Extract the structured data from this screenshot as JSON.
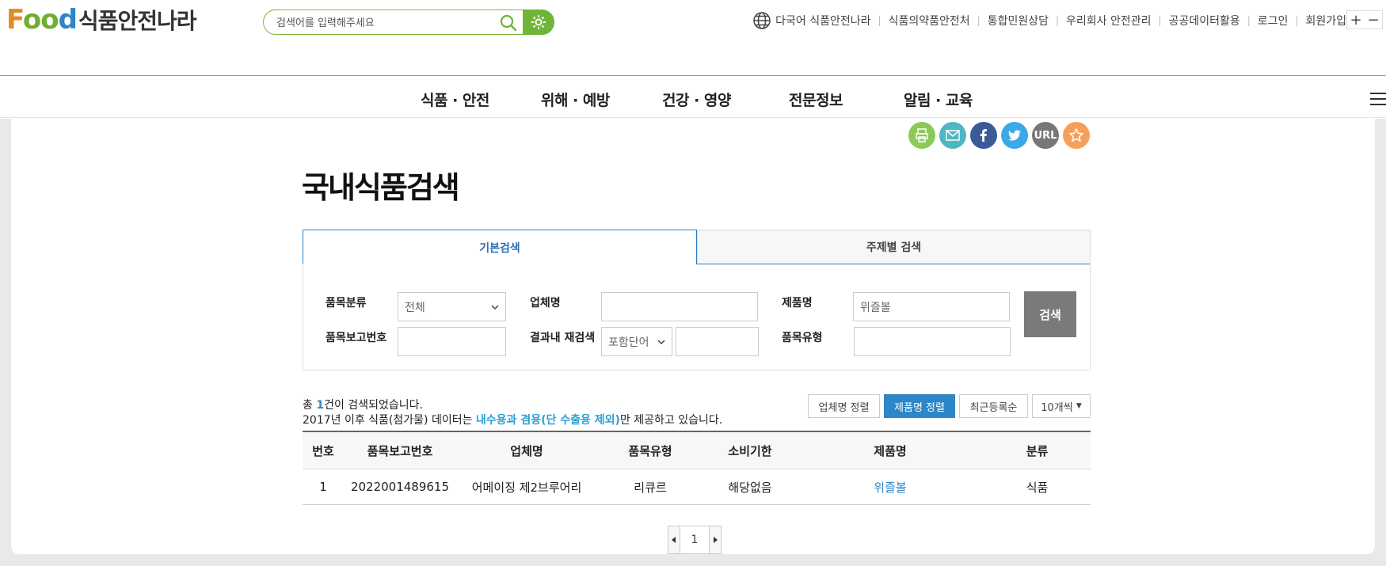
{
  "logo": {
    "en_f": "F",
    "en_oo": "oo",
    "en_d": "d",
    "kr": "식품안전나라"
  },
  "search": {
    "placeholder": "검색어를 입력해주세요"
  },
  "util_nav": [
    "다국어 식품안전나라",
    "식품의약품안전처",
    "통합민원상담",
    "우리회사 안전관리",
    "공공데이터활용",
    "로그인",
    "회원가입"
  ],
  "zoom": {
    "plus": "+",
    "minus": "−"
  },
  "main_nav": [
    "식품 · 안전",
    "위해 · 예방",
    "건강 · 영양",
    "전문정보",
    "알림 · 교육"
  ],
  "share": {
    "url_label": "URL"
  },
  "page_title": "국내식품검색",
  "tabs": {
    "basic": "기본검색",
    "subject": "주제별 검색"
  },
  "form": {
    "category_label": "품목분류",
    "category_value": "전체",
    "company_label": "업체명",
    "company_value": "",
    "product_label": "제품명",
    "product_value": "위즐볼",
    "report_no_label": "품목보고번호",
    "report_no_value": "",
    "research_label": "결과내 재검색",
    "research_option": "포함단어",
    "research_value": "",
    "type_label": "품목유형",
    "type_value": "",
    "search_button": "검색"
  },
  "result": {
    "prefix": "총 ",
    "count": "1",
    "suffix": "건이 검색되었습니다.",
    "note_before": "2017년 이후 식품(첨가물) 데이터는 ",
    "note_highlight": "내수용과 겸용(단 수출용 제외)",
    "note_after": "만 제공하고 있습니다."
  },
  "sort": {
    "by_company": "업체명 정렬",
    "by_product": "제품명 정렬",
    "recent": "최근등록순",
    "per_page": "10개씩"
  },
  "table": {
    "headers": [
      "번호",
      "품목보고번호",
      "업체명",
      "품목유형",
      "소비기한",
      "제품명",
      "분류"
    ],
    "rows": [
      [
        "1",
        "2022001489615",
        "어메이징 제2브루어리",
        "리큐르",
        "해당없음",
        "위즐볼",
        "식품"
      ]
    ]
  },
  "pager": {
    "current": "1"
  },
  "colors": {
    "green": "#6fb53a",
    "blue": "#2d86c5",
    "orange": "#f5a05a"
  }
}
